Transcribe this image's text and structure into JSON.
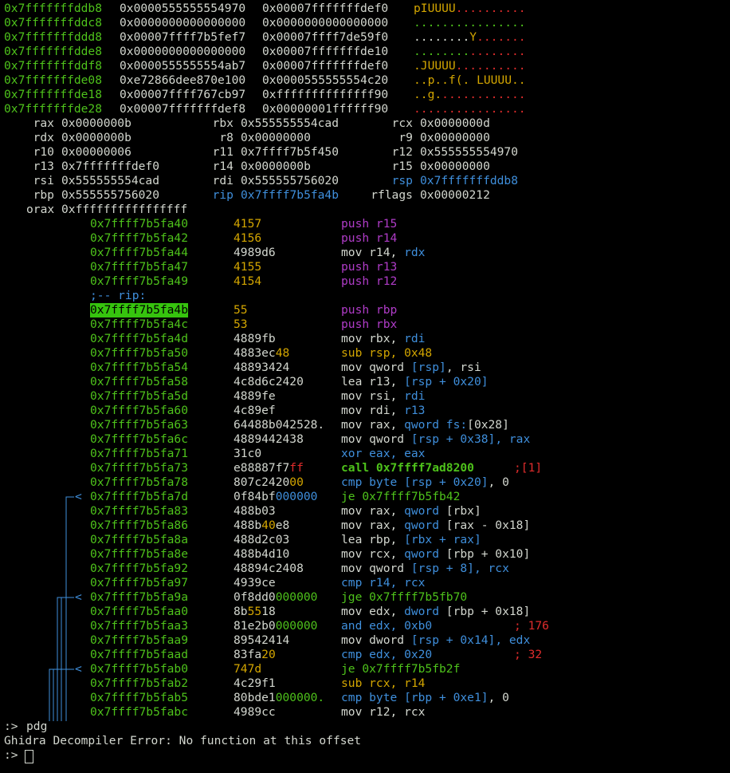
{
  "hexdump": [
    {
      "addr": "0x7fffffffddb8",
      "q1": "0x0000555555554970",
      "q2": "0x00007fffffffdef0",
      "ascii": [
        [
          "pIUUUU",
          "y"
        ],
        [
          "..........",
          "r"
        ]
      ]
    },
    {
      "addr": "0x7fffffffddc8",
      "q1": "0x0000000000000000",
      "q2": "0x0000000000000000",
      "ascii": [
        [
          "................",
          "g"
        ]
      ]
    },
    {
      "addr": "0x7fffffffddd8",
      "q1": "0x00007ffff7b5fef7",
      "q2": "0x00007ffff7de59f0",
      "ascii": [
        [
          "........",
          "w"
        ],
        [
          "Y",
          "y"
        ],
        [
          ".......",
          "r"
        ]
      ]
    },
    {
      "addr": "0x7fffffffdde8",
      "q1": "0x0000000000000000",
      "q2": "0x00007fffffffde10",
      "ascii": [
        [
          "........",
          "g"
        ],
        [
          "........",
          "r"
        ]
      ]
    },
    {
      "addr": "0x7fffffffddf8",
      "q1": "0x0000555555554ab7",
      "q2": "0x00007fffffffdef0",
      "ascii": [
        [
          ".JUUUU",
          "y"
        ],
        [
          "..........",
          "r"
        ]
      ]
    },
    {
      "addr": "0x7fffffffde08",
      "q1": "0xe72866dee870e100",
      "q2": "0x0000555555554c20",
      "ascii": [
        [
          "..p..f(. LUUUU..",
          "y"
        ]
      ]
    },
    {
      "addr": "0x7fffffffde18",
      "q1": "0x00007ffff767cb97",
      "q2": "0xffffffffffffff90",
      "ascii": [
        [
          "..g.",
          "y"
        ],
        [
          "............",
          "r"
        ]
      ]
    },
    {
      "addr": "0x7fffffffde28",
      "q1": "0x00007fffffffdef8",
      "q2": "0x00000001ffffff90",
      "ascii": [
        [
          "................",
          "r"
        ]
      ]
    }
  ],
  "registers": [
    [
      [
        "rax",
        "0x0000000b"
      ],
      [
        "rbx",
        "0x555555554cad"
      ],
      [
        "rcx",
        "0x0000000d"
      ]
    ],
    [
      [
        "rdx",
        "0x0000000b"
      ],
      [
        "r8",
        "0x00000000"
      ],
      [
        "r9",
        "0x00000000"
      ]
    ],
    [
      [
        "r10",
        "0x00000006"
      ],
      [
        "r11",
        "0x7ffff7b5f450"
      ],
      [
        "r12",
        "0x555555554970"
      ]
    ],
    [
      [
        "r13",
        "0x7fffffffdef0"
      ],
      [
        "r14",
        "0x0000000b"
      ],
      [
        "r15",
        "0x00000000"
      ]
    ],
    [
      [
        "rsi",
        "0x555555554cad"
      ],
      [
        "rdi",
        "0x555555756020"
      ],
      [
        "rsp",
        "0x7fffffffddb8"
      ]
    ],
    [
      [
        "rbp",
        "0x555555756020"
      ],
      [
        "rip",
        "0x7ffff7b5fa4b"
      ],
      [
        "rflags",
        "0x00000212"
      ]
    ]
  ],
  "orax": {
    "name": "orax",
    "value": "0xffffffffffffffff"
  },
  "rip_label": ";-- rip:",
  "disasm": [
    {
      "addr": "0x7ffff7b5fa40",
      "bytes": [
        [
          "4157",
          "y"
        ]
      ],
      "ins": [
        [
          "push r15",
          "p"
        ]
      ]
    },
    {
      "addr": "0x7ffff7b5fa42",
      "bytes": [
        [
          "4156",
          "y"
        ]
      ],
      "ins": [
        [
          "push r14",
          "p"
        ]
      ]
    },
    {
      "addr": "0x7ffff7b5fa44",
      "bytes": [
        [
          "4989d6",
          "w"
        ]
      ],
      "ins": [
        [
          "mov r14, ",
          "w"
        ],
        [
          "rdx",
          "b"
        ]
      ]
    },
    {
      "addr": "0x7ffff7b5fa47",
      "bytes": [
        [
          "4155",
          "y"
        ]
      ],
      "ins": [
        [
          "push r13",
          "p"
        ]
      ]
    },
    {
      "addr": "0x7ffff7b5fa49",
      "bytes": [
        [
          "4154",
          "y"
        ]
      ],
      "ins": [
        [
          "push r12",
          "p"
        ]
      ]
    },
    {
      "addr": "0x7ffff7b5fa4b",
      "bytes": [
        [
          "55",
          "y"
        ]
      ],
      "ins": [
        [
          "push rbp",
          "p"
        ]
      ],
      "current": true
    },
    {
      "addr": "0x7ffff7b5fa4c",
      "bytes": [
        [
          "53",
          "y"
        ]
      ],
      "ins": [
        [
          "push rbx",
          "p"
        ]
      ]
    },
    {
      "addr": "0x7ffff7b5fa4d",
      "bytes": [
        [
          "4889fb",
          "w"
        ]
      ],
      "ins": [
        [
          "mov rbx, ",
          "w"
        ],
        [
          "rdi",
          "b"
        ]
      ]
    },
    {
      "addr": "0x7ffff7b5fa50",
      "bytes": [
        [
          "4883ec",
          "w"
        ],
        [
          "48",
          "y"
        ]
      ],
      "ins": [
        [
          "sub rsp, ",
          "y"
        ],
        [
          "0x48",
          "y"
        ]
      ]
    },
    {
      "addr": "0x7ffff7b5fa54",
      "bytes": [
        [
          "48893424",
          "w"
        ]
      ],
      "ins": [
        [
          "mov qword ",
          "w"
        ],
        [
          "[rsp]",
          "b"
        ],
        [
          ", rsi",
          "w"
        ]
      ]
    },
    {
      "addr": "0x7ffff7b5fa58",
      "bytes": [
        [
          "4c8d6c2420",
          "w"
        ]
      ],
      "ins": [
        [
          "lea r13, ",
          "w"
        ],
        [
          "[rsp + 0x20]",
          "b"
        ]
      ]
    },
    {
      "addr": "0x7ffff7b5fa5d",
      "bytes": [
        [
          "4889fe",
          "w"
        ]
      ],
      "ins": [
        [
          "mov rsi, ",
          "w"
        ],
        [
          "rdi",
          "b"
        ]
      ]
    },
    {
      "addr": "0x7ffff7b5fa60",
      "bytes": [
        [
          "4c89ef",
          "w"
        ]
      ],
      "ins": [
        [
          "mov rdi, ",
          "w"
        ],
        [
          "r13",
          "b"
        ]
      ]
    },
    {
      "addr": "0x7ffff7b5fa63",
      "bytes": [
        [
          "64488b042528.",
          "w"
        ]
      ],
      "ins": [
        [
          "mov rax, ",
          "w"
        ],
        [
          "qword fs:",
          "b"
        ],
        [
          "[0x28]",
          "w"
        ]
      ]
    },
    {
      "addr": "0x7ffff7b5fa6c",
      "bytes": [
        [
          "4889442438",
          "w"
        ]
      ],
      "ins": [
        [
          "mov qword ",
          "w"
        ],
        [
          "[rsp + 0x38]",
          "b"
        ],
        [
          ", rax",
          "b"
        ]
      ]
    },
    {
      "addr": "0x7ffff7b5fa71",
      "bytes": [
        [
          "31c0",
          "w"
        ]
      ],
      "ins": [
        [
          "xor eax, eax",
          "b"
        ]
      ]
    },
    {
      "addr": "0x7ffff7b5fa73",
      "bytes": [
        [
          "e88887f7",
          "w"
        ],
        [
          "ff",
          "r"
        ]
      ],
      "ins": [
        [
          "call 0x7ffff7ad8200",
          "bold-g"
        ]
      ],
      "comment": [
        [
          ";[1]",
          "r"
        ]
      ]
    },
    {
      "addr": "0x7ffff7b5fa78",
      "bytes": [
        [
          "807c2420",
          "w"
        ],
        [
          "00",
          "y"
        ]
      ],
      "ins": [
        [
          "cmp byte ",
          "b"
        ],
        [
          "[rsp + 0x20]",
          "b"
        ],
        [
          ", 0",
          "w"
        ]
      ]
    },
    {
      "addr": "0x7ffff7b5fa7d",
      "bytes": [
        [
          "0f84bf",
          "w"
        ],
        [
          "000000",
          "b"
        ]
      ],
      "ins": [
        [
          "je 0x7ffff7b5fb42",
          "g"
        ]
      ],
      "arrow": "<"
    },
    {
      "addr": "0x7ffff7b5fa83",
      "bytes": [
        [
          "488b03",
          "w"
        ]
      ],
      "ins": [
        [
          "mov rax, ",
          "w"
        ],
        [
          "qword ",
          "b"
        ],
        [
          "[rbx]",
          "w"
        ]
      ]
    },
    {
      "addr": "0x7ffff7b5fa86",
      "bytes": [
        [
          "488b",
          "w"
        ],
        [
          "40",
          "y"
        ],
        [
          "e8",
          "w"
        ]
      ],
      "ins": [
        [
          "mov rax, ",
          "w"
        ],
        [
          "qword ",
          "b"
        ],
        [
          "[rax - 0x18]",
          "w"
        ]
      ]
    },
    {
      "addr": "0x7ffff7b5fa8a",
      "bytes": [
        [
          "488d2c03",
          "w"
        ]
      ],
      "ins": [
        [
          "lea rbp, ",
          "w"
        ],
        [
          "[rbx + rax]",
          "b"
        ]
      ]
    },
    {
      "addr": "0x7ffff7b5fa8e",
      "bytes": [
        [
          "488b4d10",
          "w"
        ]
      ],
      "ins": [
        [
          "mov rcx, ",
          "w"
        ],
        [
          "qword ",
          "b"
        ],
        [
          "[rbp + 0x10]",
          "w"
        ]
      ]
    },
    {
      "addr": "0x7ffff7b5fa92",
      "bytes": [
        [
          "48894c2408",
          "w"
        ]
      ],
      "ins": [
        [
          "mov qword ",
          "w"
        ],
        [
          "[rsp + 8]",
          "b"
        ],
        [
          ", rcx",
          "b"
        ]
      ]
    },
    {
      "addr": "0x7ffff7b5fa97",
      "bytes": [
        [
          "4939ce",
          "w"
        ]
      ],
      "ins": [
        [
          "cmp r14, rcx",
          "b"
        ]
      ]
    },
    {
      "addr": "0x7ffff7b5fa9a",
      "bytes": [
        [
          "0f8dd0",
          "w"
        ],
        [
          "000000",
          "g"
        ]
      ],
      "ins": [
        [
          "jge 0x7ffff7b5fb70",
          "g"
        ]
      ],
      "arrow": "<"
    },
    {
      "addr": "0x7ffff7b5faa0",
      "bytes": [
        [
          "8b",
          "w"
        ],
        [
          "55",
          "y"
        ],
        [
          "18",
          "w"
        ]
      ],
      "ins": [
        [
          "mov edx, ",
          "w"
        ],
        [
          "dword ",
          "b"
        ],
        [
          "[rbp + 0x18]",
          "w"
        ]
      ]
    },
    {
      "addr": "0x7ffff7b5faa3",
      "bytes": [
        [
          "81e2b0",
          "w"
        ],
        [
          "000000",
          "g"
        ]
      ],
      "ins": [
        [
          "and edx, 0xb0",
          "b"
        ]
      ],
      "comment": [
        [
          "; 176",
          "r"
        ]
      ]
    },
    {
      "addr": "0x7ffff7b5faa9",
      "bytes": [
        [
          "89542414",
          "w"
        ]
      ],
      "ins": [
        [
          "mov dword ",
          "w"
        ],
        [
          "[rsp + 0x14]",
          "b"
        ],
        [
          ", edx",
          "b"
        ]
      ]
    },
    {
      "addr": "0x7ffff7b5faad",
      "bytes": [
        [
          "83fa",
          "w"
        ],
        [
          "20",
          "y"
        ]
      ],
      "ins": [
        [
          "cmp edx, 0x20",
          "b"
        ]
      ],
      "comment": [
        [
          "; 32",
          "r"
        ]
      ]
    },
    {
      "addr": "0x7ffff7b5fab0",
      "bytes": [
        [
          "747d",
          "y"
        ]
      ],
      "ins": [
        [
          "je 0x7ffff7b5fb2f",
          "g"
        ]
      ],
      "arrow": "<"
    },
    {
      "addr": "0x7ffff7b5fab2",
      "bytes": [
        [
          "4c29f1",
          "w"
        ]
      ],
      "ins": [
        [
          "sub rcx, r14",
          "y"
        ]
      ]
    },
    {
      "addr": "0x7ffff7b5fab5",
      "bytes": [
        [
          "80bde1",
          "w"
        ],
        [
          "000000.",
          "g"
        ]
      ],
      "ins": [
        [
          "cmp byte ",
          "b"
        ],
        [
          "[rbp + 0xe1]",
          "b"
        ],
        [
          ", 0",
          "w"
        ]
      ]
    },
    {
      "addr": "0x7ffff7b5fabc",
      "bytes": [
        [
          "4989cc",
          "w"
        ]
      ],
      "ins": [
        [
          "mov r12, rcx",
          "w"
        ]
      ]
    }
  ],
  "console": {
    "prompt": ":>",
    "cmd": "pdg",
    "error": "Ghidra Decompiler Error: No function at this offset"
  }
}
